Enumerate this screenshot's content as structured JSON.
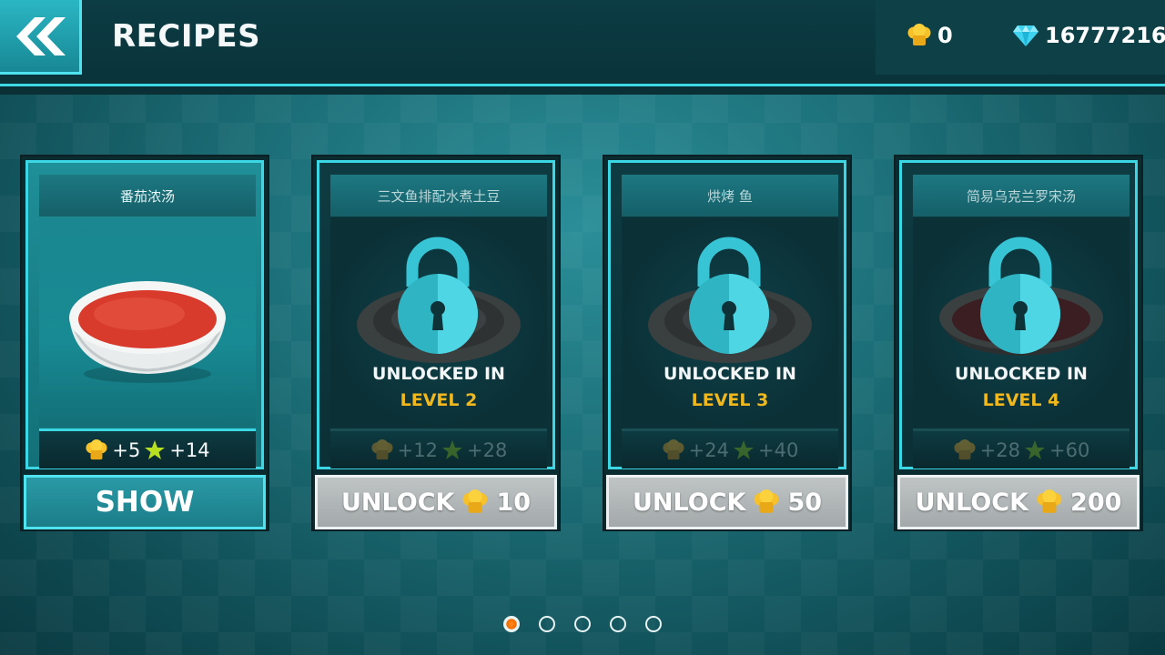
{
  "header": {
    "title": "RECIPES",
    "back_icon": "double-chevron-left-icon",
    "chef_coins": "0",
    "gems": "16777216"
  },
  "colors": {
    "accent": "#3fd9e6",
    "level_text": "#f0b81c",
    "active_dot": "#f06a00"
  },
  "cards": [
    {
      "name": "番茄浓汤",
      "state": "unlocked",
      "reward_coins": "+5",
      "reward_stars": "+14",
      "button_label": "SHOW"
    },
    {
      "name": "三文鱼排配水煮土豆",
      "state": "locked",
      "unlock_line1": "UNLOCKED IN",
      "unlock_line2": "LEVEL 2",
      "reward_coins": "+12",
      "reward_stars": "+28",
      "button_label": "UNLOCK",
      "price": "10"
    },
    {
      "name": "烘烤 鱼",
      "state": "locked",
      "unlock_line1": "UNLOCKED IN",
      "unlock_line2": "LEVEL 3",
      "reward_coins": "+24",
      "reward_stars": "+40",
      "button_label": "UNLOCK",
      "price": "50"
    },
    {
      "name": "简易乌克兰罗宋汤",
      "state": "locked",
      "unlock_line1": "UNLOCKED IN",
      "unlock_line2": "LEVEL 4",
      "reward_coins": "+28",
      "reward_stars": "+60",
      "button_label": "UNLOCK",
      "price": "200"
    }
  ],
  "pagination": {
    "pages": 5,
    "current": 1
  }
}
